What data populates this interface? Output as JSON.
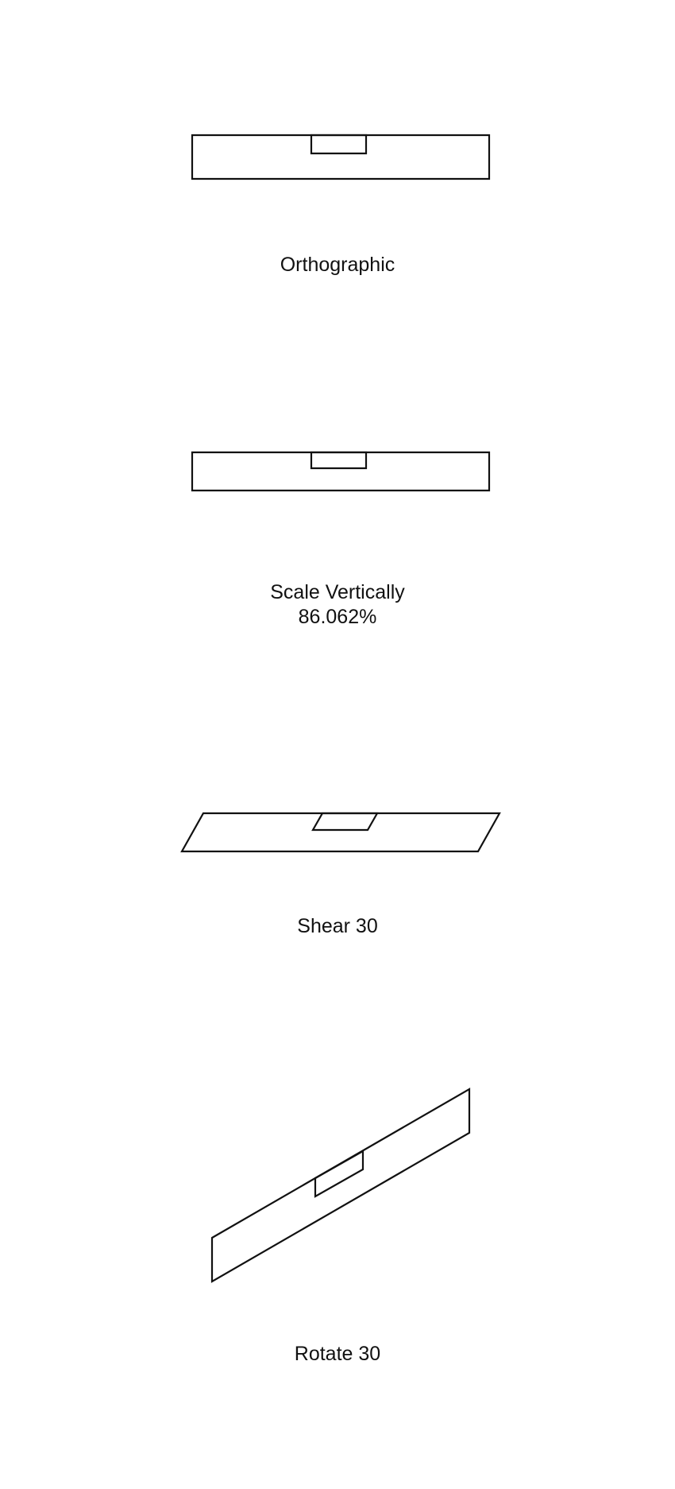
{
  "panels": [
    {
      "id": "orthographic",
      "label": "Orthographic",
      "sublabel": ""
    },
    {
      "id": "scale",
      "label": "Scale Vertically",
      "sublabel": "86.062%"
    },
    {
      "id": "shear",
      "label": "Shear 30",
      "sublabel": ""
    },
    {
      "id": "rotate",
      "label": "Rotate 30",
      "sublabel": ""
    }
  ]
}
